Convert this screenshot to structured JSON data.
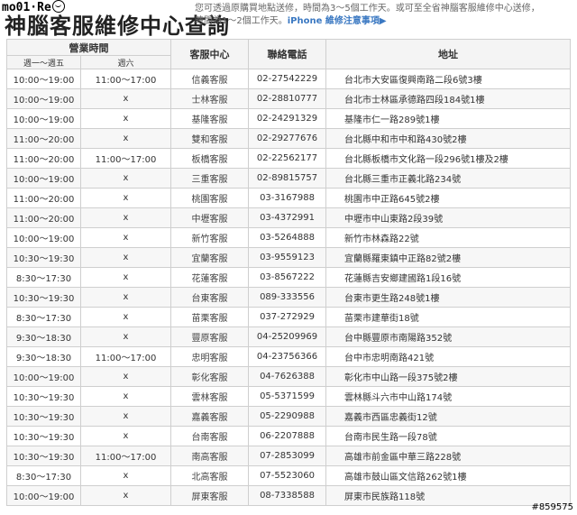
{
  "header": {
    "logo_text": "mo01·Re",
    "title": "神腦客服維修中心查詢",
    "note_line1": "您可透過原購買地點送修，時間為3～5個工作天。或可至全省神腦客服維修中心送修，",
    "note_line2": "時間為1～2個工作天。",
    "iphone_link": "iPhone 維修注意事項",
    "iphone_chevron": "▶"
  },
  "table": {
    "headers": {
      "hours": "營業時間",
      "weekday": "週一～週五",
      "saturday": "週六",
      "service_center": "客服中心",
      "phone": "聯絡電話",
      "address": "地址"
    },
    "rows": [
      {
        "weekday": "10:00～19:00",
        "saturday": "11:00～17:00",
        "center": "信義客服",
        "phone": "02-27542229",
        "address": "台北市大安區復興南路二段6號3樓"
      },
      {
        "weekday": "10:00～19:00",
        "saturday": "x",
        "center": "士林客服",
        "phone": "02-28810777",
        "address": "台北市士林區承德路四段184號1樓"
      },
      {
        "weekday": "10:00～19:00",
        "saturday": "x",
        "center": "基隆客服",
        "phone": "02-24291329",
        "address": "基隆市仁一路289號1樓"
      },
      {
        "weekday": "11:00～20:00",
        "saturday": "x",
        "center": "雙和客服",
        "phone": "02-29277676",
        "address": "台北縣中和市中和路430號2樓"
      },
      {
        "weekday": "11:00～20:00",
        "saturday": "11:00～17:00",
        "center": "板橋客服",
        "phone": "02-22562177",
        "address": "台北縣板橋市文化路一段296號1樓及2樓"
      },
      {
        "weekday": "10:00～19:00",
        "saturday": "x",
        "center": "三重客服",
        "phone": "02-89815757",
        "address": "台北縣三重市正義北路234號"
      },
      {
        "weekday": "11:00～20:00",
        "saturday": "x",
        "center": "桃園客服",
        "phone": "03-3167988",
        "address": "桃園市中正路645號2樓"
      },
      {
        "weekday": "11:00～20:00",
        "saturday": "x",
        "center": "中壢客服",
        "phone": "03-4372991",
        "address": "中壢市中山東路2段39號"
      },
      {
        "weekday": "10:00～19:00",
        "saturday": "x",
        "center": "新竹客服",
        "phone": "03-5264888",
        "address": "新竹市林森路22號"
      },
      {
        "weekday": "10:30～19:30",
        "saturday": "x",
        "center": "宜蘭客服",
        "phone": "03-9559123",
        "address": "宜蘭縣羅東鎮中正路82號2樓"
      },
      {
        "weekday": "8:30～17:30",
        "saturday": "x",
        "center": "花蓮客服",
        "phone": "03-8567222",
        "address": "花蓮縣吉安鄉建國路1段16號"
      },
      {
        "weekday": "10:30～19:30",
        "saturday": "x",
        "center": "台東客服",
        "phone": "089-333556",
        "address": "台東市更生路248號1樓"
      },
      {
        "weekday": "8:30～17:30",
        "saturday": "x",
        "center": "苗栗客服",
        "phone": "037-272929",
        "address": "苗栗市建華街18號"
      },
      {
        "weekday": "9:30～18:30",
        "saturday": "x",
        "center": "豐原客服",
        "phone": "04-25209969",
        "address": "台中縣豐原市南陽路352號"
      },
      {
        "weekday": "9:30～18:30",
        "saturday": "11:00～17:00",
        "center": "忠明客服",
        "phone": "04-23756366",
        "address": "台中市忠明南路421號"
      },
      {
        "weekday": "10:00～19:00",
        "saturday": "x",
        "center": "彰化客服",
        "phone": "04-7626388",
        "address": "彰化市中山路一段375號2樓"
      },
      {
        "weekday": "10:30～19:30",
        "saturday": "x",
        "center": "雲林客服",
        "phone": "05-5371599",
        "address": "雲林縣斗六市中山路174號"
      },
      {
        "weekday": "10:30～19:30",
        "saturday": "x",
        "center": "嘉義客服",
        "phone": "05-2290988",
        "address": "嘉義市西區忠義街12號"
      },
      {
        "weekday": "10:30～19:30",
        "saturday": "x",
        "center": "台南客服",
        "phone": "06-2207888",
        "address": "台南市民生路一段78號"
      },
      {
        "weekday": "10:30～19:30",
        "saturday": "11:00～17:00",
        "center": "南高客服",
        "phone": "07-2853099",
        "address": "高雄市前金區中華三路228號"
      },
      {
        "weekday": "8:30～17:30",
        "saturday": "x",
        "center": "北高客服",
        "phone": "07-5523060",
        "address": "高雄市鼓山區文信路262號1樓"
      },
      {
        "weekday": "10:00～19:00",
        "saturday": "x",
        "center": "屏東客服",
        "phone": "08-7338588",
        "address": "屏東市民族路118號"
      }
    ]
  },
  "watermark": "#859575"
}
